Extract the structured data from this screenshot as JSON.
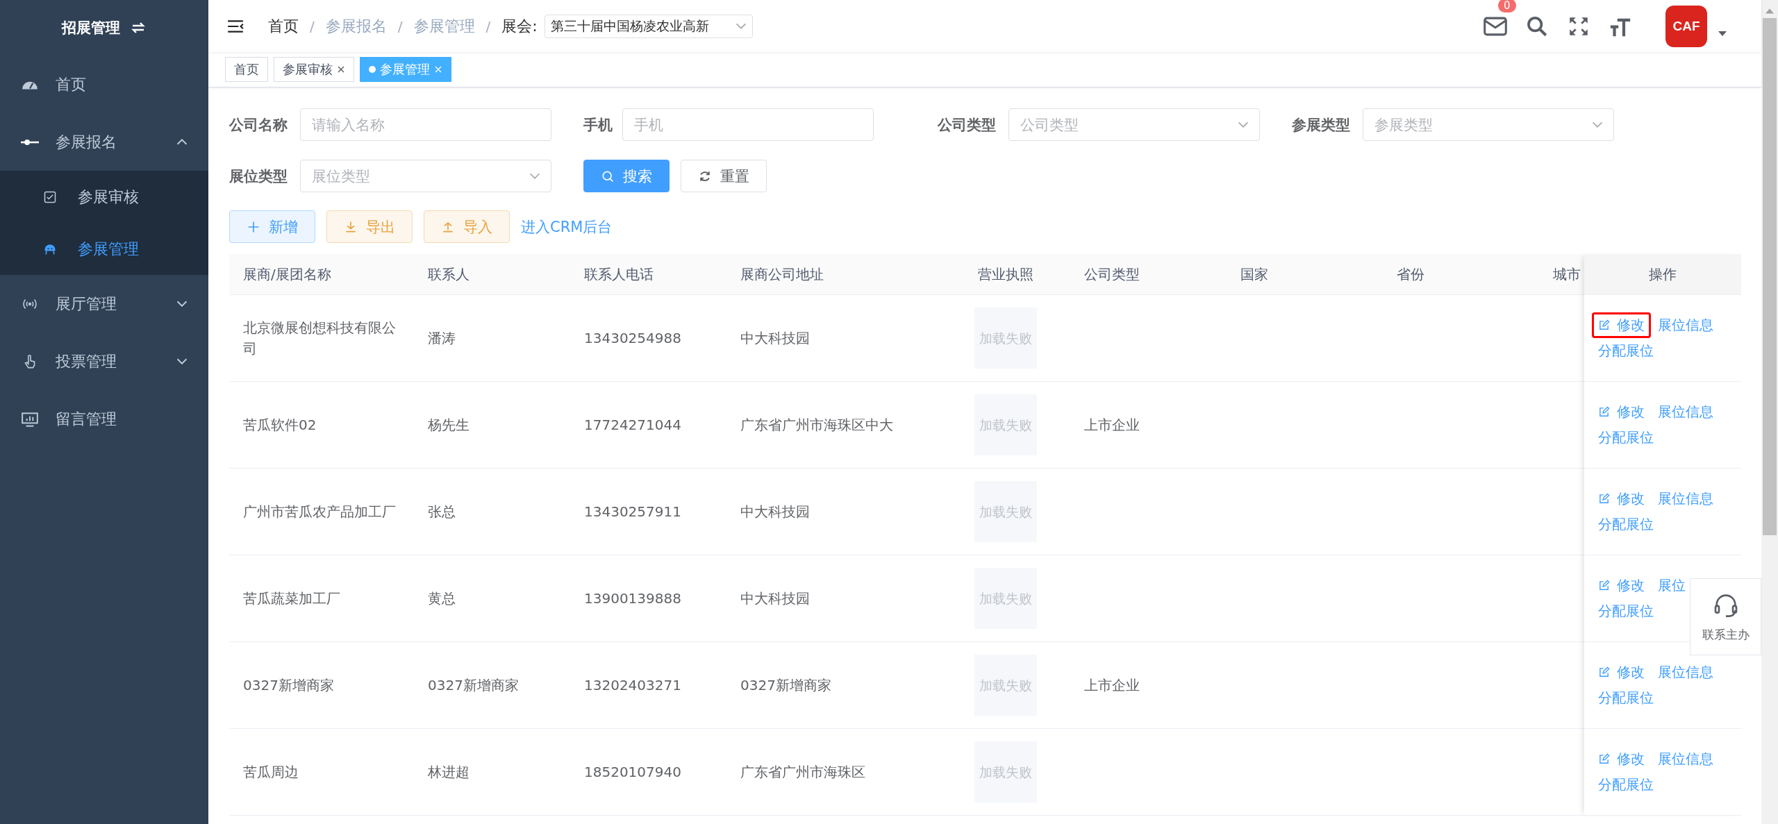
{
  "sidebar": {
    "title": "招展管理",
    "items": [
      {
        "label": "首页",
        "selected": false
      },
      {
        "label": "参展报名",
        "selected": false,
        "expanded": true,
        "children": [
          {
            "label": "参展审核",
            "selected": false
          },
          {
            "label": "参展管理",
            "selected": true
          }
        ]
      },
      {
        "label": "展厅管理",
        "selected": false,
        "expanded": false
      },
      {
        "label": "投票管理",
        "selected": false,
        "expanded": false
      },
      {
        "label": "留言管理",
        "selected": false
      }
    ]
  },
  "breadcrumb": [
    {
      "label": "首页",
      "separator": "/"
    },
    {
      "label": "参展报名",
      "separator": "/"
    },
    {
      "label": "参展管理",
      "separator": "/"
    }
  ],
  "exhibition": {
    "label": "展会:",
    "value": "第三十届中国杨凌农业高新"
  },
  "header": {
    "mail_badge": "0",
    "logo_text": "CAF"
  },
  "tabs": [
    {
      "label": "首页",
      "selected": false,
      "closable": false
    },
    {
      "label": "参展审核",
      "selected": false,
      "closable": true
    },
    {
      "label": "参展管理",
      "selected": true,
      "closable": true
    }
  ],
  "filters": [
    {
      "label": "公司名称",
      "placeholder": "请输入名称",
      "kind": "input"
    },
    {
      "label": "手机",
      "placeholder": "手机",
      "kind": "input"
    },
    {
      "label": "公司类型",
      "placeholder": "公司类型",
      "kind": "select"
    },
    {
      "label": "参展类型",
      "placeholder": "参展类型",
      "kind": "select"
    },
    {
      "label": "展位类型",
      "placeholder": "展位类型",
      "kind": "select"
    }
  ],
  "filter_buttons": [
    {
      "label": "搜索",
      "kind": "search"
    },
    {
      "label": "重置",
      "kind": "reset"
    }
  ],
  "actions": [
    {
      "label": "新增",
      "kind": "add"
    },
    {
      "label": "导出",
      "kind": "export"
    },
    {
      "label": "导入",
      "kind": "import"
    },
    {
      "label": "进入CRM后台",
      "kind": "link"
    }
  ],
  "table": {
    "columns": [
      "展商/展团名称",
      "联系人",
      "联系人电话",
      "展商公司地址",
      "营业执照",
      "公司类型",
      "国家",
      "省份",
      "城市"
    ],
    "action_column": "操作",
    "rows": [
      {
        "name": "北京微展创想科技有限公司",
        "contact": "潘涛",
        "phone": "13430254988",
        "address": "中大科技园",
        "license": "加载失败",
        "actions": [
          "修改",
          "展位信息",
          "分配展位"
        ],
        "highlighted": true
      },
      {
        "name": "苦瓜软件02",
        "contact": "杨先生",
        "phone": "17724271044",
        "address": "广东省广州市海珠区中大",
        "license": "加载失败",
        "company_type": "上市企业",
        "actions": [
          "修改",
          "展位信息",
          "分配展位"
        ],
        "highlighted": false
      },
      {
        "name": "广州市苦瓜农产品加工厂",
        "contact": "张总",
        "phone": "13430257911",
        "address": "中大科技园",
        "license": "加载失败",
        "actions": [
          "修改",
          "展位信息",
          "分配展位"
        ],
        "highlighted": false
      },
      {
        "name": "苦瓜蔬菜加工厂",
        "contact": "黄总",
        "phone": "13900139888",
        "address": "中大科技园",
        "license": "加载失败",
        "actions": [
          "修改",
          "展位",
          "分配展位"
        ],
        "highlighted": false
      },
      {
        "name": "0327新增商家",
        "contact": "0327新增商家",
        "phone": "13202403271",
        "address": "0327新增商家",
        "license": "加载失败",
        "company_type": "上市企业",
        "actions": [
          "修改",
          "展位信息",
          "分配展位"
        ],
        "highlighted": false
      },
      {
        "name": "苦瓜周边",
        "contact": "林进超",
        "phone": "18520107940",
        "address": "广东省广州市海珠区",
        "license": "加载失败",
        "actions": [
          "修改",
          "展位信息",
          "分配展位"
        ],
        "highlighted": false
      }
    ]
  },
  "contact_widget": {
    "label": "联系主办"
  }
}
